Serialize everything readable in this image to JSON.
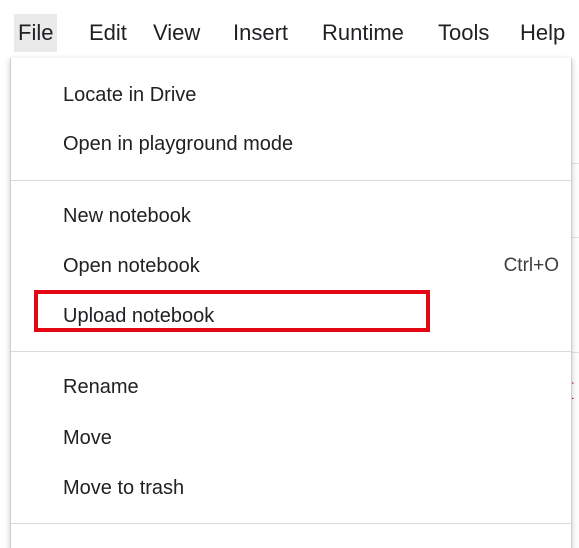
{
  "menubar": {
    "items": [
      {
        "label": "File",
        "active": true
      },
      {
        "label": "Edit"
      },
      {
        "label": "View"
      },
      {
        "label": "Insert"
      },
      {
        "label": "Runtime"
      },
      {
        "label": "Tools"
      },
      {
        "label": "Help"
      }
    ]
  },
  "file_menu": {
    "groups": [
      [
        {
          "label": "Locate in Drive"
        },
        {
          "label": "Open in playground mode"
        }
      ],
      [
        {
          "label": "New notebook"
        },
        {
          "label": "Open notebook",
          "shortcut": "Ctrl+O"
        },
        {
          "label": "Upload notebook",
          "highlighted": true
        }
      ],
      [
        {
          "label": "Rename"
        },
        {
          "label": "Move"
        },
        {
          "label": "Move to trash"
        }
      ]
    ]
  },
  "colors": {
    "highlight_border": "#e30613",
    "menu_text": "#202124",
    "active_tab_bg": "#eaeaea"
  },
  "background": {
    "partial_glyph": "I"
  }
}
